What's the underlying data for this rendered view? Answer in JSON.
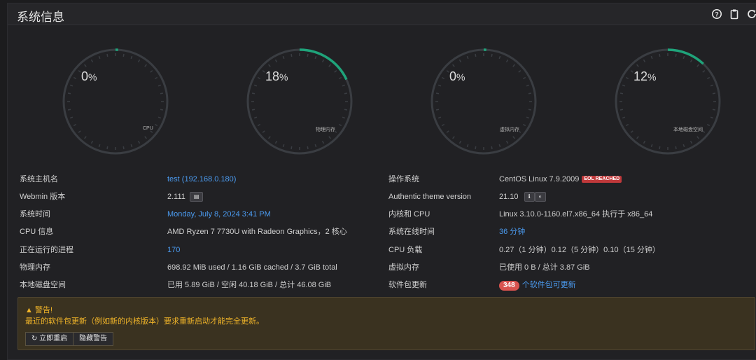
{
  "header": {
    "title": "系统信息"
  },
  "gauges": [
    {
      "percent": "0",
      "label": "CPU",
      "fraction": 0.0
    },
    {
      "percent": "18",
      "label": "物理内存",
      "fraction": 0.18
    },
    {
      "percent": "0",
      "label": "虚拟内存",
      "fraction": 0.0
    },
    {
      "percent": "12",
      "label": "本地磁盘空间",
      "fraction": 0.12
    }
  ],
  "pct_sign": "%",
  "left_info": [
    {
      "key": "系统主机名",
      "value": "test (192.168.0.180)"
    },
    {
      "key": "Webmin 版本",
      "value": "2.111"
    },
    {
      "key": "系统时间",
      "value": "Monday, July 8, 2024 3:41 PM"
    },
    {
      "key": "CPU 信息",
      "value": "AMD Ryzen 7 7730U with Radeon Graphics，2 核心"
    },
    {
      "key": "正在运行的进程",
      "value": "170"
    },
    {
      "key": "物理内存",
      "value": "698.92 MiB used / 1.16 GiB cached / 3.7 GiB total"
    },
    {
      "key": "本地磁盘空间",
      "value": "已用 5.89 GiB / 空闲 40.18 GiB / 总计 46.08 GiB"
    }
  ],
  "right_info": [
    {
      "key": "操作系统",
      "value": "CentOS Linux 7.9.2009",
      "badge": "EOL REACHED"
    },
    {
      "key": "Authentic theme version",
      "value": "21.10"
    },
    {
      "key": "内核和 CPU",
      "value": "Linux 3.10.0-1160.el7.x86_64 执行于 x86_64"
    },
    {
      "key": "系统在线时间",
      "value": "36 分钟"
    },
    {
      "key": "CPU 负载",
      "value": "0.27（1 分钟）0.12（5 分钟）0.10（15 分钟）"
    },
    {
      "key": "虚拟内存",
      "value": "已使用 0 B / 总计 3.87 GiB"
    },
    {
      "key": "软件包更新",
      "count": "348",
      "value": "个软件包可更新"
    }
  ],
  "warning": {
    "title": "警告!",
    "text": "最近的软件包更新（例如新的内核版本）要求重新启动才能完全更新。",
    "restart_label": "立即重启",
    "hide_label": "隐藏警告"
  },
  "colors": {
    "accent": "#1fa37a",
    "track": "#3a3d42",
    "link": "#4b9bf0",
    "warning": "#f0b429"
  },
  "icons": [
    "help-icon",
    "clipboard-icon",
    "refresh-icon",
    "warning-icon"
  ]
}
